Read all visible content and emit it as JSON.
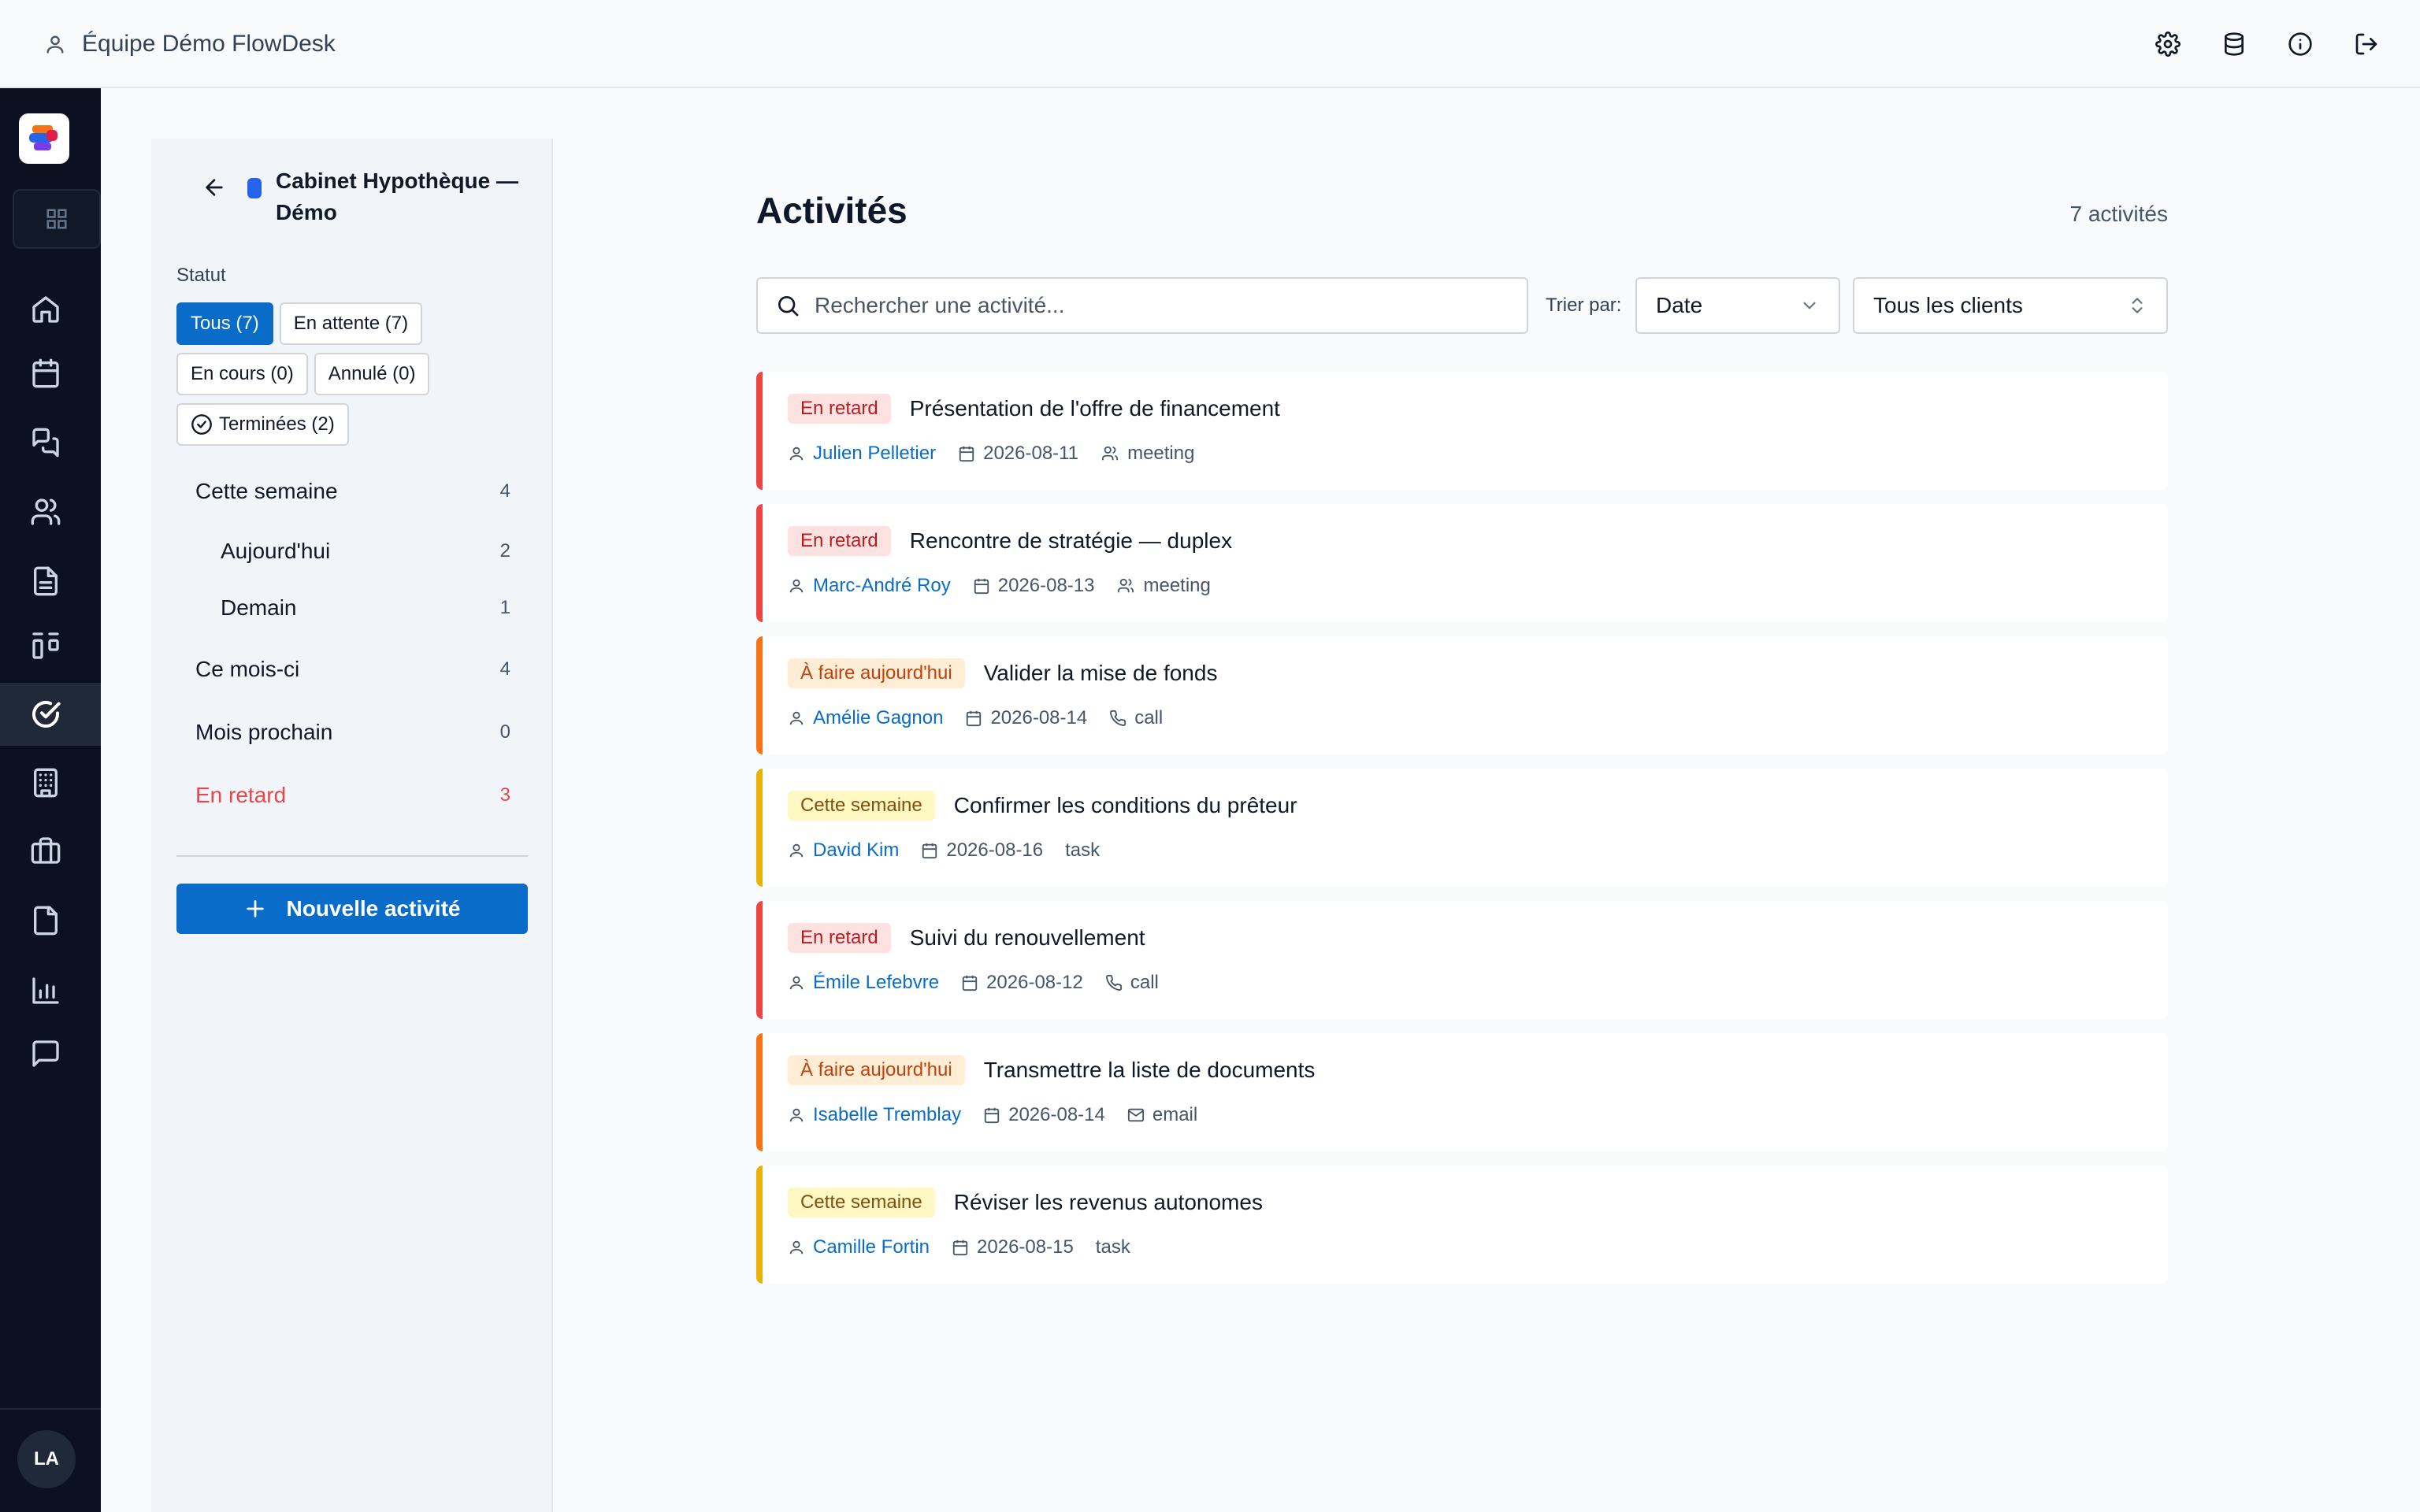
{
  "header": {
    "team_name": "Équipe Démo FlowDesk"
  },
  "user": {
    "initials": "LA"
  },
  "panel": {
    "title": "Cabinet Hypothèque — Démo",
    "status_label": "Statut",
    "chips": [
      "Tous (7)",
      "En attente (7)",
      "En cours (0)",
      "Annulé (0)",
      "Terminées (2)"
    ],
    "groups": [
      {
        "label": "Cette semaine",
        "count": "4"
      },
      {
        "label": "Aujourd'hui",
        "count": "2"
      },
      {
        "label": "Demain",
        "count": "1"
      },
      {
        "label": "Ce mois-ci",
        "count": "4"
      },
      {
        "label": "Mois prochain",
        "count": "0"
      },
      {
        "label": "En retard",
        "count": "3"
      }
    ],
    "new_button": "Nouvelle activité"
  },
  "main": {
    "title": "Activités",
    "count": "7 activités",
    "search_placeholder": "Rechercher une activité...",
    "sort_label": "Trier par:",
    "sort_value": "Date",
    "client_filter": "Tous les clients"
  },
  "colors": {
    "accent": "#0a6cc9",
    "late": "#ef4444",
    "today": "#f97316",
    "week": "#eab308"
  },
  "activities": [
    {
      "badge": "En retard",
      "title": "Présentation de l'offre de financement",
      "person": "Julien Pelletier",
      "date": "2026-08-11",
      "type": "meeting"
    },
    {
      "badge": "En retard",
      "title": "Rencontre de stratégie — duplex",
      "person": "Marc-André Roy",
      "date": "2026-08-13",
      "type": "meeting"
    },
    {
      "badge": "À faire aujourd'hui",
      "title": "Valider la mise de fonds",
      "person": "Amélie Gagnon",
      "date": "2026-08-14",
      "type": "call"
    },
    {
      "badge": "Cette semaine",
      "title": "Confirmer les conditions du prêteur",
      "person": "David Kim",
      "date": "2026-08-16",
      "type": "task"
    },
    {
      "badge": "En retard",
      "title": "Suivi du renouvellement",
      "person": "Émile Lefebvre",
      "date": "2026-08-12",
      "type": "call"
    },
    {
      "badge": "À faire aujourd'hui",
      "title": "Transmettre la liste de documents",
      "person": "Isabelle Tremblay",
      "date": "2026-08-14",
      "type": "email"
    },
    {
      "badge": "Cette semaine",
      "title": "Réviser les revenus autonomes",
      "person": "Camille Fortin",
      "date": "2026-08-15",
      "type": "task"
    }
  ]
}
